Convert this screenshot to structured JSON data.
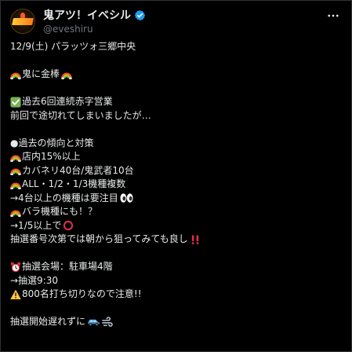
{
  "header": {
    "display_name": "鬼アツ！イベシル",
    "handle": "@eveshiru"
  },
  "tweet": {
    "line_date": "12/9(土) パラッツォ三郷中央",
    "line_title": "鬼に金棒",
    "line_streak": "過去6回連続赤字営業",
    "line_streak_note": "前回で途切れてしまいましたが…",
    "line_trend_header": "●過去の傾向と対策",
    "line_store": "店内15%以上",
    "line_kabaneri": "カバネリ40台/鬼武者10台",
    "line_all": "ALL・1/2・1/3機種複数",
    "line_four_units": "→4台以上の機種は要注目",
    "line_bara": "バラ機種にも！？",
    "line_fifth": "→1/5以上で",
    "line_lottery": "抽選番号次第では朝から狙ってみても良し",
    "line_venue": "抽選会場：駐車場4階",
    "line_time": "→抽選9:30",
    "line_cutoff": "800名打ち切りなので注意!!",
    "line_closing": "抽選開始遅れずに"
  },
  "icons": {
    "verified": "verified-badge-icon",
    "more": "more-options-icon",
    "rainbow": "rainbow-icon",
    "check": "check-mark-icon",
    "eyes": "eyes-icon",
    "circle": "red-circle-icon",
    "exclamation": "double-exclamation-icon",
    "clock": "alarm-clock-icon",
    "warning": "warning-icon",
    "car": "car-icon",
    "dash": "dash-icon"
  },
  "colors": {
    "background": "#000000",
    "text": "#e7e9ea",
    "secondary_text": "#71767b",
    "verified_blue": "#1d9bf0",
    "check_green": "#77b255",
    "alert_red": "#dd2e44",
    "warning_yellow": "#ffcc4d"
  }
}
